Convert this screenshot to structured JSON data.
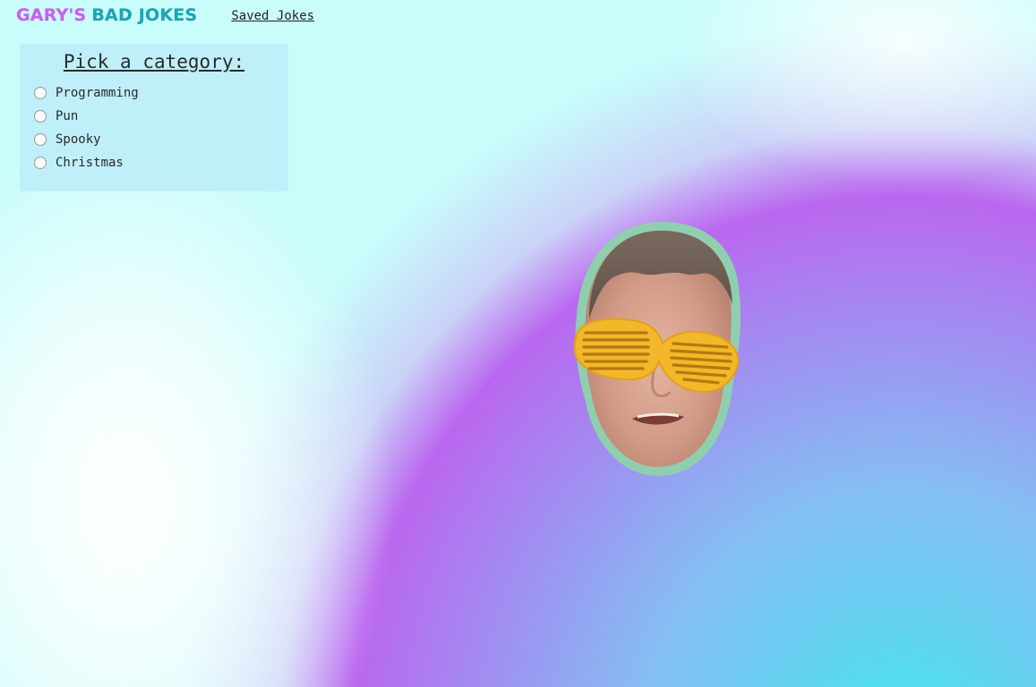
{
  "header": {
    "logo_part_1": "GARY'S",
    "logo_part_2": "BAD JOKES",
    "nav_saved_jokes": "Saved Jokes"
  },
  "category_panel": {
    "title": "Pick a category:",
    "options": [
      {
        "label": "Programming",
        "selected": false
      },
      {
        "label": "Pun",
        "selected": false
      },
      {
        "label": "Spooky",
        "selected": false
      },
      {
        "label": "Christmas",
        "selected": false
      }
    ]
  },
  "mascot": {
    "icon": "gary-face-with-shutter-shades-icon"
  },
  "colors": {
    "logo_pink": "#d15ef0",
    "logo_teal": "#1aa7b6",
    "panel_bg": "#beeef8",
    "face_outline": "#8fcfb0",
    "glasses": "#f4b72a"
  }
}
